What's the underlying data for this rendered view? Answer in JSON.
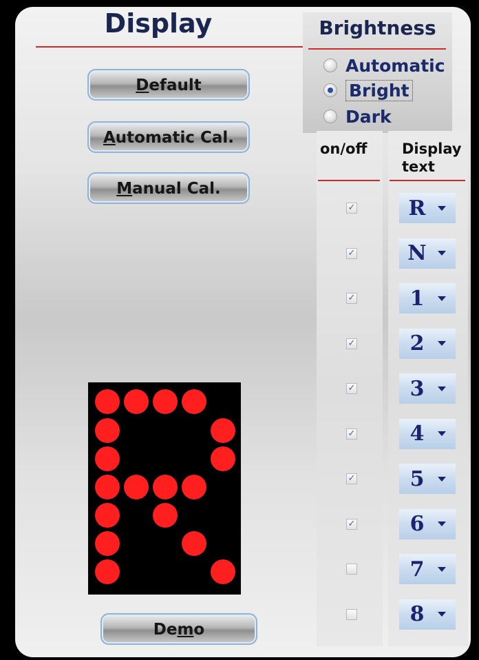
{
  "display": {
    "title": "Display",
    "buttons": {
      "default_label": "Default",
      "auto_cal_label": "Automatic Cal.",
      "manual_cal_label": "Manual Cal.",
      "demo_label": "Demo"
    },
    "matrix_letter": "R"
  },
  "brightness": {
    "title": "Brightness",
    "options": [
      "Automatic",
      "Bright",
      "Dark"
    ],
    "selected": "Bright"
  },
  "columns": {
    "onoff_header": "on/off",
    "display_header_line1": "Display",
    "display_header_line2": "text"
  },
  "rows": [
    {
      "checked": true,
      "text": "R"
    },
    {
      "checked": true,
      "text": "N"
    },
    {
      "checked": true,
      "text": "1"
    },
    {
      "checked": true,
      "text": "2"
    },
    {
      "checked": true,
      "text": "3"
    },
    {
      "checked": true,
      "text": "4"
    },
    {
      "checked": true,
      "text": "5"
    },
    {
      "checked": true,
      "text": "6"
    },
    {
      "checked": false,
      "text": "7"
    },
    {
      "checked": false,
      "text": "8"
    }
  ],
  "colors": {
    "title": "#1a2550",
    "accent_line": "#cc2b2b",
    "led_on": "#ff1f1f",
    "dropdown_text": "#1b2370"
  }
}
